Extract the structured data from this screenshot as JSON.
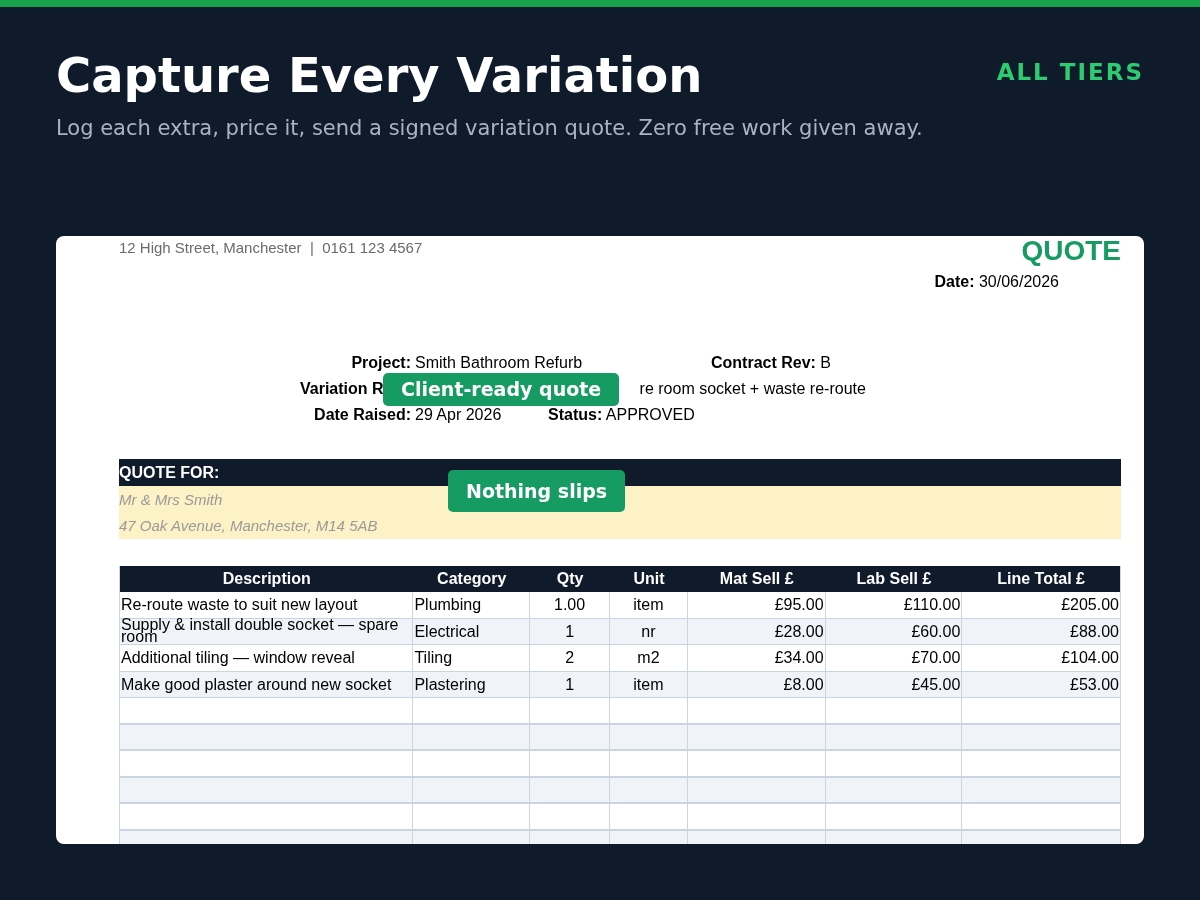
{
  "header": {
    "title": "Capture Every Variation",
    "tier": "ALL TIERS",
    "subtitle": "Log each extra, price it, send a signed variation quote. Zero free work given away."
  },
  "document": {
    "company_line": "12 High Street, Manchester  |  0161 123 4567",
    "doc_title": "QUOTE",
    "date_label": "Date:",
    "date_value": "30/06/2026",
    "meta": {
      "project_label": "Project:",
      "project_value": "Smith Bathroom Refurb",
      "contract_label": "Contract Rev:",
      "contract_value": "B",
      "variation_label": "Variation R",
      "variation_value": "re room socket + waste re-route",
      "raised_label": "Date Raised:",
      "raised_value": "29 Apr 2026",
      "status_label": "Status:",
      "status_value": "APPROVED"
    },
    "quote_for": {
      "heading": "QUOTE FOR:",
      "lines": [
        "Mr & Mrs Smith",
        "47 Oak Avenue, Manchester, M14 5AB"
      ]
    },
    "table": {
      "columns": [
        "Description",
        "Category",
        "Qty",
        "Unit",
        "Mat Sell £",
        "Lab Sell £",
        "Line Total £"
      ],
      "rows": [
        [
          "Re-route waste to suit new layout",
          "Plumbing",
          "1.00",
          "item",
          "£95.00",
          "£110.00",
          "£205.00"
        ],
        [
          "Supply & install double socket — spare room",
          "Electrical",
          "1",
          "nr",
          "£28.00",
          "£60.00",
          "£88.00"
        ],
        [
          "Additional tiling — window reveal",
          "Tiling",
          "2",
          "m2",
          "£34.00",
          "£70.00",
          "£104.00"
        ],
        [
          "Make good plaster around new socket",
          "Plastering",
          "1",
          "item",
          "£8.00",
          "£45.00",
          "£53.00"
        ]
      ]
    }
  },
  "callouts": [
    "Client-ready quote",
    "Nothing slips"
  ]
}
